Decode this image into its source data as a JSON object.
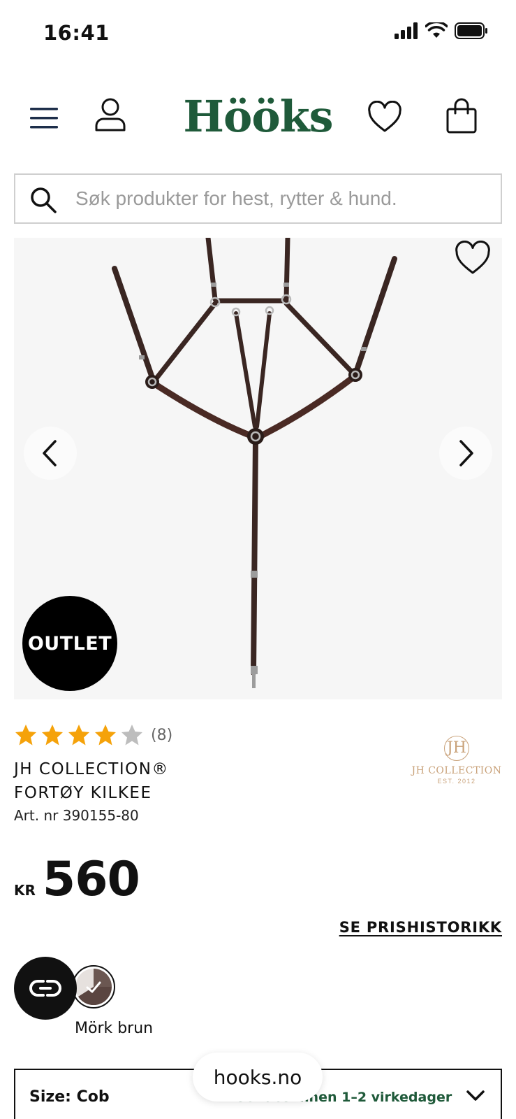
{
  "status_bar": {
    "time": "16:41"
  },
  "header": {
    "logo": "Hööks"
  },
  "search": {
    "placeholder": "Søk produkter for hest, rytter & hund."
  },
  "gallery": {
    "badge": "OUTLET"
  },
  "product": {
    "rating": 4,
    "rating_max": 5,
    "review_count": "(8)",
    "brand": "JH COLLECTION®",
    "name": "FORTØY KILKEE",
    "article": "Art. nr 390155-80",
    "currency": "KR",
    "price": "560",
    "price_history": "SE PRISHISTORIKK",
    "color_name": "Mörk brun",
    "size_label": "Size: Cob",
    "delivery": "Sendes innen 1–2 virkedager"
  },
  "brand_logo": {
    "monogram": "JH",
    "name": "JH COLLECTION",
    "sub": "EST. 2012"
  },
  "browser": {
    "url": "hooks.no"
  },
  "colors": {
    "logo_green": "#1f5a3a",
    "star_gold": "#f5a20a",
    "star_gray": "#bdbdbd",
    "brand_gold": "#c9a27a"
  }
}
